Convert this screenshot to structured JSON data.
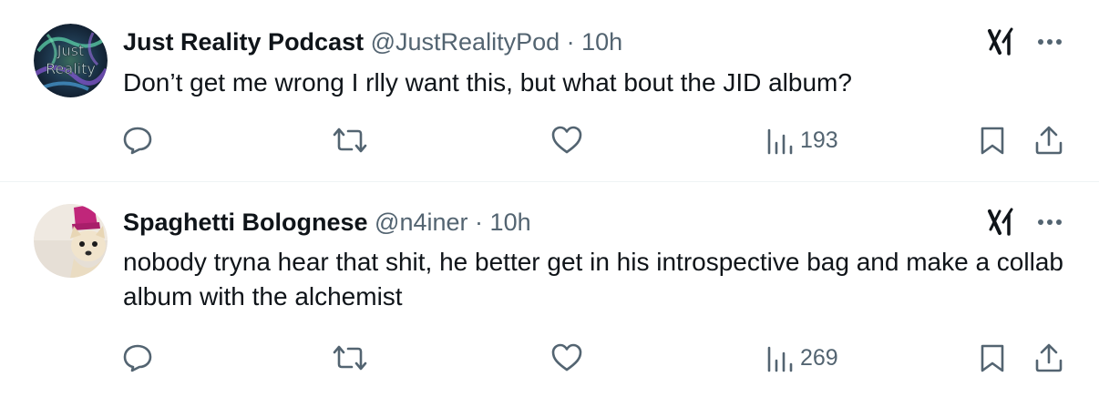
{
  "tweets": [
    {
      "display_name": "Just Reality Podcast",
      "handle": "@JustRealityPod",
      "separator": "·",
      "time": "10h",
      "text": "Don’t get me wrong I rlly want this, but what bout the JID album?",
      "avatar_text": [
        "Just",
        "Reality"
      ],
      "views": "193",
      "icons": [
        "reply-icon",
        "retweet-icon",
        "like-icon",
        "views-icon",
        "bookmark-icon",
        "share-icon",
        "grok-icon",
        "more-icon"
      ]
    },
    {
      "display_name": "Spaghetti Bolognese",
      "handle": "@n4iner",
      "separator": "·",
      "time": "10h",
      "text": "nobody tryna hear that shit, he better get in his introspective bag and make a collab album with the alchemist",
      "avatar_text": [],
      "views": "269",
      "icons": [
        "reply-icon",
        "retweet-icon",
        "like-icon",
        "views-icon",
        "bookmark-icon",
        "share-icon",
        "grok-icon",
        "more-icon"
      ]
    }
  ],
  "colors": {
    "text_primary": "#0f1419",
    "text_secondary": "#536471",
    "divider": "#eff3f4"
  }
}
